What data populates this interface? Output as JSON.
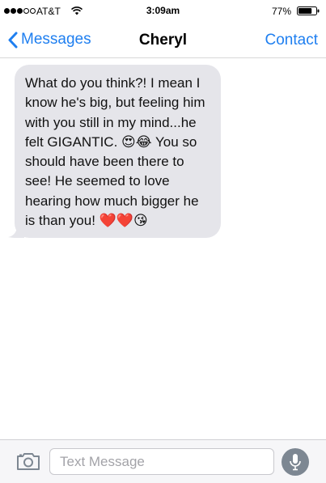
{
  "status_bar": {
    "signal_strength": "3 of 5 dots",
    "carrier": "AT&T",
    "time": "3:09am",
    "battery_percent": "77%",
    "battery_level": 0.77
  },
  "nav": {
    "back_label": "Messages",
    "title": "Cheryl",
    "contact_label": "Contact"
  },
  "messages": [
    {
      "direction": "incoming",
      "text": "What do you think?! I mean I know he's big, but feeling him with you still in my mind...he felt GIGANTIC. 😍😂 You so should have been there to see! He seemed to love hearing how much bigger he is than you! ❤️❤️😘"
    }
  ],
  "input": {
    "placeholder": "Text Message",
    "value": ""
  },
  "icons": {
    "back": "chevron-left-icon",
    "camera": "camera-icon",
    "mic": "microphone-icon",
    "wifi": "wifi-icon",
    "battery": "battery-icon"
  },
  "colors": {
    "accent": "#1f7ff0",
    "bubble_incoming": "#e5e5ea",
    "mic_button": "#7d8792"
  }
}
